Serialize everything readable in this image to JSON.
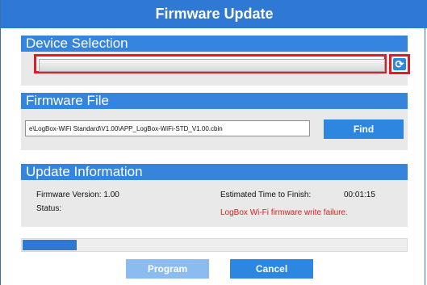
{
  "window": {
    "title": "Firmware Update"
  },
  "device_selection": {
    "heading": "Device Selection",
    "selected_value": "",
    "refresh_icon": "refresh-icon",
    "dropdown_icon": "triangle-down-icon"
  },
  "firmware_file": {
    "heading": "Firmware File",
    "path": "e\\LogBox-WiFi Standard\\V1.00\\APP_LogBox-WiFi-STD_V1.00.cbin",
    "find_label": "Find"
  },
  "update_information": {
    "heading": "Update Information",
    "firmware_version_label": "Firmware Version: 1.00",
    "status_label": "Status:",
    "estimated_time_label": "Estimated Time to Finish:",
    "estimated_time_value": "00:01:15",
    "status_value": "LogBox Wi-Fi firmware write failure."
  },
  "progress": {
    "fraction": 0.14
  },
  "actions": {
    "program_label": "Program",
    "cancel_label": "Cancel"
  },
  "colors": {
    "accent": "#2d86e0",
    "error": "#e01b23",
    "disabled_button": "#8cbcef"
  }
}
